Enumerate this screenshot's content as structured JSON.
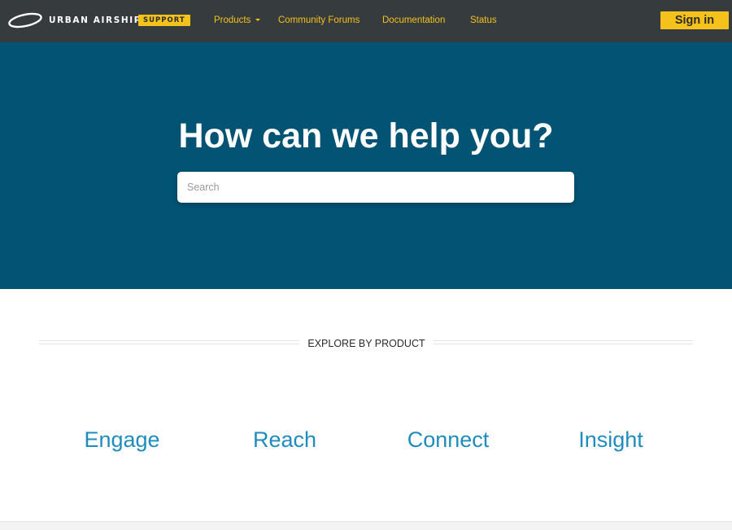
{
  "header": {
    "logo_text": "URBAN AIRSHIP",
    "badge": "SUPPORT",
    "nav": [
      {
        "label": "Products"
      },
      {
        "label": "Community Forums"
      },
      {
        "label": "Documentation"
      },
      {
        "label": "Status"
      }
    ],
    "signin_label": "Sign in"
  },
  "hero": {
    "title": "How can we help you?",
    "search_placeholder": "Search"
  },
  "explore": {
    "heading": "EXPLORE BY PRODUCT",
    "products": [
      {
        "label": "Engage"
      },
      {
        "label": "Reach"
      },
      {
        "label": "Connect"
      },
      {
        "label": "Insight"
      }
    ]
  },
  "colors": {
    "nav_bg": "#363b3e",
    "accent": "#f5c21b",
    "hero_bg": "#035374",
    "product_link": "#1f8cbd"
  },
  "icons": [
    "airship-logo-icon",
    "chevron-down-icon"
  ]
}
